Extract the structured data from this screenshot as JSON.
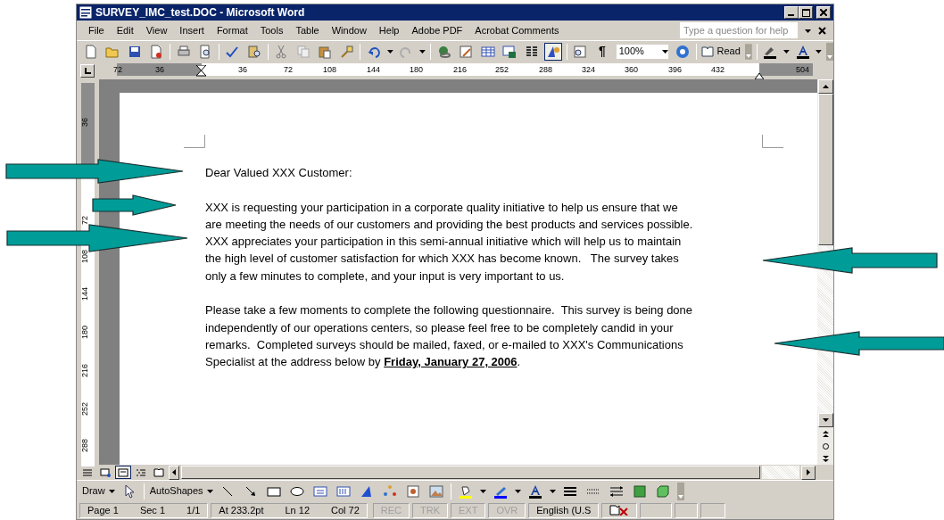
{
  "window": {
    "title": "SURVEY_IMC_test.DOC - Microsoft Word"
  },
  "menu": [
    "File",
    "Edit",
    "View",
    "Insert",
    "Format",
    "Tools",
    "Table",
    "Window",
    "Help",
    "Adobe PDF",
    "Acrobat Comments"
  ],
  "help_box": {
    "placeholder": "Type a question for help"
  },
  "standard_toolbar": {
    "show_hide_mark": "¶",
    "zoom": "100%",
    "read_button": "Read",
    "drawing_button_pressed": true
  },
  "horizontal_ruler": [
    "72",
    "36",
    "36",
    "72",
    "108",
    "144",
    "180",
    "216",
    "252",
    "288",
    "324",
    "360",
    "396",
    "432",
    "504"
  ],
  "vertical_ruler": [
    "36",
    "72",
    "108",
    "144",
    "180",
    "216",
    "252",
    "288"
  ],
  "document": {
    "paragraphs": [
      [
        "Dear Valued XXX Customer:"
      ],
      [
        "XXX is requesting your participation in a corporate quality initiative to help us ensure that we",
        "are meeting the needs of our customers and providing the best products and services possible.",
        "XXX appreciates your participation in this semi-annual initiative which will help us to maintain",
        "the high level of customer satisfaction for which XXX has become known.   The survey takes",
        "only a few minutes to complete, and your input is very important to us."
      ],
      [
        "Please take a few moments to complete the following questionnaire.  This survey is being done",
        "independently of our operations centers, so please feel free to be completely candid in your",
        "remarks.  Completed surveys should be mailed, faxed, or e-mailed to XXX's Communications",
        "Specialist at the address below by **Friday, January 27, 2006**."
      ]
    ]
  },
  "view_buttons": [
    {
      "selected": false
    },
    {
      "selected": false
    },
    {
      "selected": true
    },
    {
      "selected": false
    },
    {
      "selected": false
    }
  ],
  "drawing_toolbar": {
    "draw": "Draw",
    "autoshapes": "AutoShapes"
  },
  "status_bar": [
    {
      "items": [
        {
          "text": "Page 1",
          "disabled": false
        },
        {
          "text": "Sec 1",
          "disabled": false
        },
        {
          "text": "1/1",
          "disabled": false
        }
      ]
    },
    {
      "items": [
        {
          "text": "At 233.2pt",
          "disabled": false
        },
        {
          "text": "Ln 12",
          "disabled": false
        },
        {
          "text": "Col 72",
          "disabled": false
        }
      ]
    },
    {
      "items": [
        {
          "text": "REC",
          "disabled": true
        }
      ]
    },
    {
      "items": [
        {
          "text": "TRK",
          "disabled": true
        }
      ]
    },
    {
      "items": [
        {
          "text": "EXT",
          "disabled": true
        }
      ]
    },
    {
      "items": [
        {
          "text": "OVR",
          "disabled": true
        }
      ]
    },
    {
      "items": [
        {
          "text": "English (U.S",
          "disabled": false
        }
      ]
    }
  ]
}
